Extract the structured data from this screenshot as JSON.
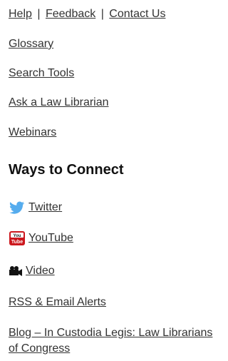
{
  "top_links": {
    "help": "Help",
    "feedback": "Feedback",
    "contact": "Contact Us",
    "separator": "|"
  },
  "links": {
    "glossary": "Glossary",
    "search_tools": "Search Tools",
    "ask_librarian": "Ask a Law Librarian",
    "webinars": "Webinars"
  },
  "connect": {
    "heading": "Ways to Connect",
    "twitter": "Twitter",
    "youtube": "YouTube",
    "video": "Video",
    "rss": "RSS & Email Alerts",
    "blog": "Blog – In Custodia Legis: Law Librarians of Congress"
  },
  "icons": {
    "twitter": "twitter-bird-icon",
    "youtube": "youtube-icon",
    "video": "video-camera-icon"
  },
  "colors": {
    "text": "#333333",
    "twitter_blue": "#55acee",
    "youtube_red": "#cc181e"
  }
}
